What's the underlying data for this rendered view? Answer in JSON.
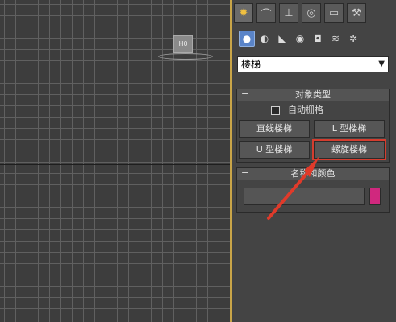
{
  "viewport": {
    "cube_label": "H0"
  },
  "command_panel": {
    "tabs": [
      {
        "name": "create-tab",
        "icon": "sun-icon"
      },
      {
        "name": "modify-tab",
        "icon": "curve-icon"
      },
      {
        "name": "hierarchy-tab",
        "icon": "hierarchy-icon"
      },
      {
        "name": "motion-tab",
        "icon": "target-icon"
      },
      {
        "name": "display-tab",
        "icon": "monitor-icon"
      },
      {
        "name": "utilities-tab",
        "icon": "hammer-icon"
      }
    ],
    "category_icons": [
      {
        "name": "geometry-icon"
      },
      {
        "name": "shapes-icon"
      },
      {
        "name": "lights-icon"
      },
      {
        "name": "cameras-icon"
      },
      {
        "name": "helpers-icon"
      },
      {
        "name": "spacewarps-icon"
      },
      {
        "name": "systems-icon"
      }
    ],
    "dropdown": {
      "value": "楼梯"
    },
    "object_type": {
      "title": "对象类型",
      "minus": "−",
      "autogrid_label": "自动栅格",
      "buttons": [
        "直线楼梯",
        "L 型楼梯",
        "U 型楼梯",
        "螺旋楼梯"
      ]
    },
    "name_color": {
      "title": "名称和颜色",
      "minus": "−",
      "name_value": "",
      "swatch_color": "#d0287e"
    }
  },
  "colors": {
    "highlight": "#d43d2f",
    "arrow": "#e03a2a",
    "viewport_border": "#c9a548"
  }
}
